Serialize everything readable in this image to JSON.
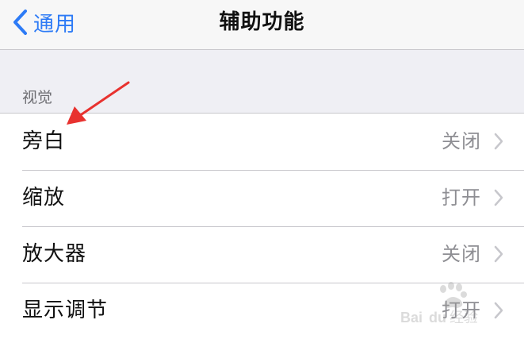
{
  "navbar": {
    "back_label": "通用",
    "title": "辅助功能"
  },
  "section": {
    "header": "视觉"
  },
  "rows": [
    {
      "label": "旁白",
      "value": "关闭"
    },
    {
      "label": "缩放",
      "value": "打开"
    },
    {
      "label": "放大器",
      "value": "关闭"
    },
    {
      "label": "显示调节",
      "value": "打开"
    }
  ],
  "colors": {
    "accent": "#2d7bf6",
    "annotation_arrow": "#e8322f",
    "background": "#efeff4",
    "secondary_text": "#8e8e93"
  },
  "icons": {
    "back": "chevron-left-icon",
    "disclosure": "chevron-right-icon",
    "watermark": "baidu-paw-watermark"
  }
}
